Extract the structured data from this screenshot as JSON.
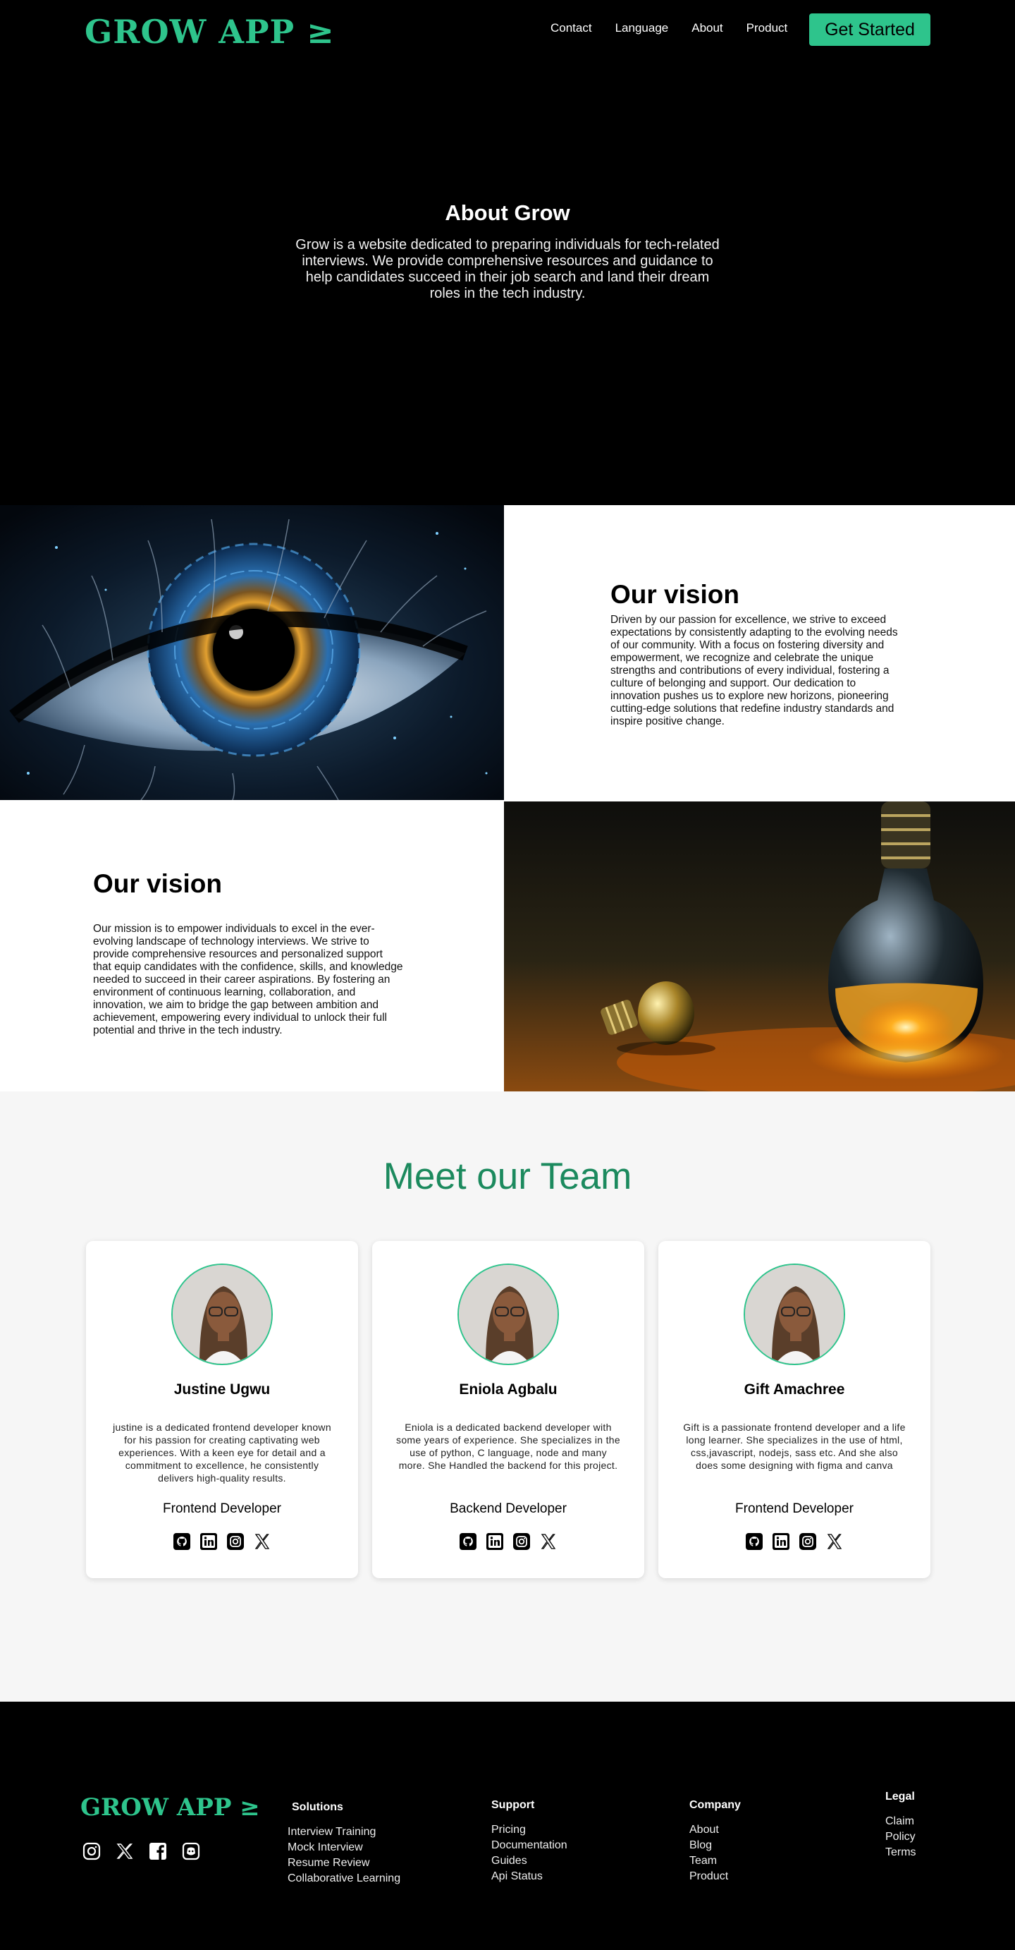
{
  "nav": {
    "logo": "GROW APP ≥",
    "links": [
      "Contact",
      "Language",
      "About",
      "Product"
    ],
    "cta": "Get Started"
  },
  "about": {
    "title": "About Grow",
    "text": "Grow is a website dedicated to preparing individuals for tech-related interviews. We provide comprehensive resources and guidance to help candidates succeed in their job search and land their dream roles in the tech industry."
  },
  "vision1": {
    "title": "Our vision",
    "text": "Driven by our passion for excellence, we strive to exceed expectations by consistently adapting to the evolving needs of our community. With a focus on fostering diversity and empowerment, we recognize and celebrate the unique strengths and contributions of every individual, fostering a culture of belonging and support. Our dedication to innovation pushes us to explore new horizons, pioneering cutting-edge solutions that redefine industry standards and inspire positive change."
  },
  "vision2": {
    "title": "Our vision",
    "text": "Our mission is to empower individuals to excel in the ever-evolving landscape of technology interviews. We strive to provide comprehensive resources and personalized support that equip candidates with the confidence, skills, and knowledge needed to succeed in their career aspirations. By fostering an environment of continuous learning, collaboration, and innovation, we aim to bridge the gap between ambition and achievement, empowering every individual to unlock their full potential and thrive in the tech industry."
  },
  "team": {
    "title": "Meet our Team",
    "members": [
      {
        "name": "Justine Ugwu",
        "bio": "justine is a dedicated frontend developer known for his passion for creating captivating web experiences. With a keen eye for detail and a commitment to excellence, he consistently delivers high-quality results.",
        "role": "Frontend Developer"
      },
      {
        "name": "Eniola Agbalu",
        "bio": "Eniola is a dedicated backend developer with some years of experience. She specializes in the use of python, C language, node and many more. She Handled the backend for this project.",
        "role": "Backend Developer"
      },
      {
        "name": "Gift Amachree",
        "bio": "Gift is a passionate frontend developer and a life long learner. She specializes in the use of html, css,javascript, nodejs, sass etc. And she also does some designing with figma and canva",
        "role": "Frontend Developer"
      }
    ]
  },
  "footer": {
    "logo": "GROW APP ≥",
    "solutions": {
      "title": "Solutions",
      "items": [
        "Interview Training",
        "Mock Interview",
        "Resume Review",
        "Collaborative Learning"
      ]
    },
    "support": {
      "title": "Support",
      "items": [
        "Pricing",
        "Documentation",
        "Guides",
        "Api Status"
      ]
    },
    "company": {
      "title": "Company",
      "items": [
        "About",
        "Blog",
        "Team",
        "Product"
      ]
    },
    "legal": {
      "title": "Legal",
      "items": [
        "Claim",
        "Policy",
        "Terms"
      ]
    }
  },
  "colors": {
    "accent": "#2ec48c",
    "team_title": "#1c8a5e"
  },
  "icons": [
    "github-icon",
    "linkedin-icon",
    "instagram-icon",
    "x-icon",
    "facebook-icon",
    "discord-icon"
  ]
}
